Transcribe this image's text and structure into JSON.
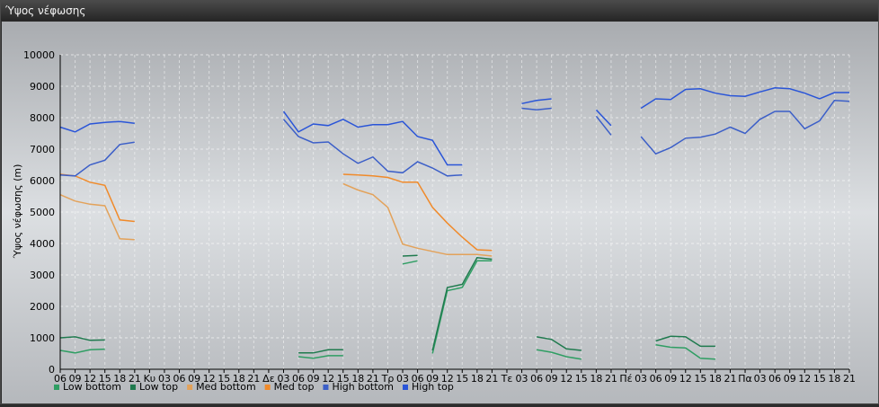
{
  "window": {
    "title": "Ύψος νέφωσης"
  },
  "chart_data": {
    "type": "line",
    "ylabel": "Ύψος νέφωσης (m)",
    "ylim": [
      0,
      10000
    ],
    "yticks": [
      0,
      1000,
      2000,
      3000,
      4000,
      5000,
      6000,
      7000,
      8000,
      9000,
      10000
    ],
    "grid": true,
    "legend_position": "bottom-left",
    "categories": [
      "06",
      "09",
      "12",
      "15",
      "18",
      "21",
      "Κυ",
      "03",
      "06",
      "09",
      "12",
      "15",
      "18",
      "21",
      "Δε",
      "03",
      "06",
      "09",
      "12",
      "15",
      "18",
      "21",
      "Τρ",
      "03",
      "06",
      "09",
      "12",
      "15",
      "18",
      "21",
      "Τε",
      "03",
      "06",
      "09",
      "12",
      "15",
      "18",
      "21",
      "Πέ",
      "03",
      "06",
      "09",
      "12",
      "15",
      "18",
      "21",
      "Πα",
      "03",
      "06",
      "09",
      "12",
      "15",
      "18",
      "21"
    ],
    "series": [
      {
        "name": "Low bottom",
        "color": "#2f9e63",
        "segments": [
          [
            [
              0,
              600
            ],
            [
              1,
              520
            ],
            [
              2,
              620
            ],
            [
              3,
              640
            ]
          ],
          [
            [
              16,
              400
            ],
            [
              17,
              350
            ],
            [
              18,
              430
            ],
            [
              19,
              430
            ]
          ],
          [
            [
              23,
              3350
            ],
            [
              24,
              3450
            ]
          ],
          [
            [
              25,
              500
            ],
            [
              26,
              2500
            ],
            [
              27,
              2600
            ],
            [
              28,
              3450
            ],
            [
              29,
              3450
            ]
          ],
          [
            [
              32,
              620
            ],
            [
              33,
              540
            ],
            [
              34,
              400
            ],
            [
              35,
              320
            ]
          ],
          [
            [
              40,
              780
            ],
            [
              41,
              700
            ],
            [
              42,
              680
            ],
            [
              43,
              350
            ],
            [
              44,
              320
            ]
          ]
        ]
      },
      {
        "name": "Low top",
        "color": "#1f7a4e",
        "segments": [
          [
            [
              0,
              1000
            ],
            [
              1,
              1030
            ],
            [
              2,
              920
            ],
            [
              3,
              930
            ]
          ],
          [
            [
              16,
              520
            ],
            [
              17,
              520
            ],
            [
              18,
              620
            ],
            [
              19,
              620
            ]
          ],
          [
            [
              23,
              3600
            ],
            [
              24,
              3620
            ]
          ],
          [
            [
              25,
              600
            ],
            [
              26,
              2600
            ],
            [
              27,
              2700
            ],
            [
              28,
              3550
            ],
            [
              29,
              3500
            ]
          ],
          [
            [
              32,
              1030
            ],
            [
              33,
              950
            ],
            [
              34,
              650
            ],
            [
              35,
              600
            ]
          ],
          [
            [
              40,
              900
            ],
            [
              41,
              1050
            ],
            [
              42,
              1030
            ],
            [
              43,
              730
            ],
            [
              44,
              730
            ]
          ]
        ]
      },
      {
        "name": "Med bottom",
        "color": "#e3a25a",
        "segments": [
          [
            [
              0,
              5550
            ],
            [
              1,
              5350
            ],
            [
              2,
              5250
            ],
            [
              3,
              5200
            ],
            [
              4,
              4150
            ],
            [
              5,
              4120
            ]
          ],
          [
            [
              19,
              5900
            ],
            [
              20,
              5700
            ],
            [
              21,
              5550
            ],
            [
              22,
              5150
            ],
            [
              23,
              3980
            ],
            [
              24,
              3850
            ],
            [
              25,
              3750
            ],
            [
              26,
              3650
            ],
            [
              27,
              3650
            ],
            [
              28,
              3650
            ],
            [
              29,
              3600
            ]
          ]
        ]
      },
      {
        "name": "Med top",
        "color": "#f08a2a",
        "segments": [
          [
            [
              0,
              6200
            ],
            [
              1,
              6150
            ],
            [
              2,
              5950
            ],
            [
              3,
              5850
            ],
            [
              4,
              4750
            ],
            [
              5,
              4700
            ]
          ],
          [
            [
              19,
              6200
            ],
            [
              20,
              6180
            ],
            [
              21,
              6150
            ],
            [
              22,
              6100
            ],
            [
              23,
              5950
            ],
            [
              24,
              5950
            ],
            [
              25,
              5150
            ],
            [
              26,
              4650
            ],
            [
              27,
              4200
            ],
            [
              28,
              3800
            ],
            [
              29,
              3780
            ]
          ]
        ]
      },
      {
        "name": "High bottom",
        "color": "#3c5fc8",
        "segments": [
          [
            [
              0,
              6180
            ],
            [
              1,
              6150
            ],
            [
              2,
              6500
            ],
            [
              3,
              6650
            ],
            [
              4,
              7150
            ],
            [
              5,
              7220
            ]
          ],
          [
            [
              15,
              7950
            ],
            [
              16,
              7400
            ],
            [
              17,
              7200
            ],
            [
              18,
              7230
            ],
            [
              19,
              6850
            ],
            [
              20,
              6550
            ],
            [
              21,
              6750
            ],
            [
              22,
              6300
            ],
            [
              23,
              6250
            ],
            [
              24,
              6600
            ],
            [
              25,
              6400
            ],
            [
              26,
              6150
            ],
            [
              27,
              6180
            ]
          ],
          [
            [
              31,
              8300
            ],
            [
              32,
              8250
            ],
            [
              33,
              8300
            ]
          ],
          [
            [
              36,
              8050
            ],
            [
              37,
              7450
            ]
          ],
          [
            [
              39,
              7400
            ],
            [
              40,
              6850
            ],
            [
              41,
              7050
            ],
            [
              42,
              7350
            ],
            [
              43,
              7380
            ],
            [
              44,
              7480
            ],
            [
              45,
              7700
            ],
            [
              46,
              7500
            ],
            [
              47,
              7950
            ],
            [
              48,
              8200
            ],
            [
              49,
              8200
            ],
            [
              50,
              7650
            ],
            [
              51,
              7900
            ],
            [
              52,
              8550
            ],
            [
              53,
              8520
            ]
          ]
        ]
      },
      {
        "name": "High top",
        "color": "#2a55d8",
        "segments": [
          [
            [
              0,
              7700
            ],
            [
              1,
              7550
            ],
            [
              2,
              7800
            ],
            [
              3,
              7850
            ],
            [
              4,
              7880
            ],
            [
              5,
              7820
            ]
          ],
          [
            [
              15,
              8200
            ],
            [
              16,
              7550
            ],
            [
              17,
              7800
            ],
            [
              18,
              7750
            ],
            [
              19,
              7950
            ],
            [
              20,
              7700
            ],
            [
              21,
              7780
            ],
            [
              22,
              7780
            ],
            [
              23,
              7880
            ],
            [
              24,
              7400
            ],
            [
              25,
              7280
            ],
            [
              26,
              6500
            ],
            [
              27,
              6500
            ]
          ],
          [
            [
              31,
              8450
            ],
            [
              32,
              8550
            ],
            [
              33,
              8600
            ]
          ],
          [
            [
              36,
              8250
            ],
            [
              37,
              7750
            ]
          ],
          [
            [
              39,
              8300
            ],
            [
              40,
              8600
            ],
            [
              41,
              8580
            ],
            [
              42,
              8900
            ],
            [
              43,
              8920
            ],
            [
              44,
              8780
            ],
            [
              45,
              8700
            ],
            [
              46,
              8680
            ],
            [
              47,
              8820
            ],
            [
              48,
              8950
            ],
            [
              49,
              8920
            ],
            [
              50,
              8780
            ],
            [
              51,
              8600
            ],
            [
              52,
              8800
            ],
            [
              53,
              8800
            ]
          ]
        ]
      }
    ]
  }
}
